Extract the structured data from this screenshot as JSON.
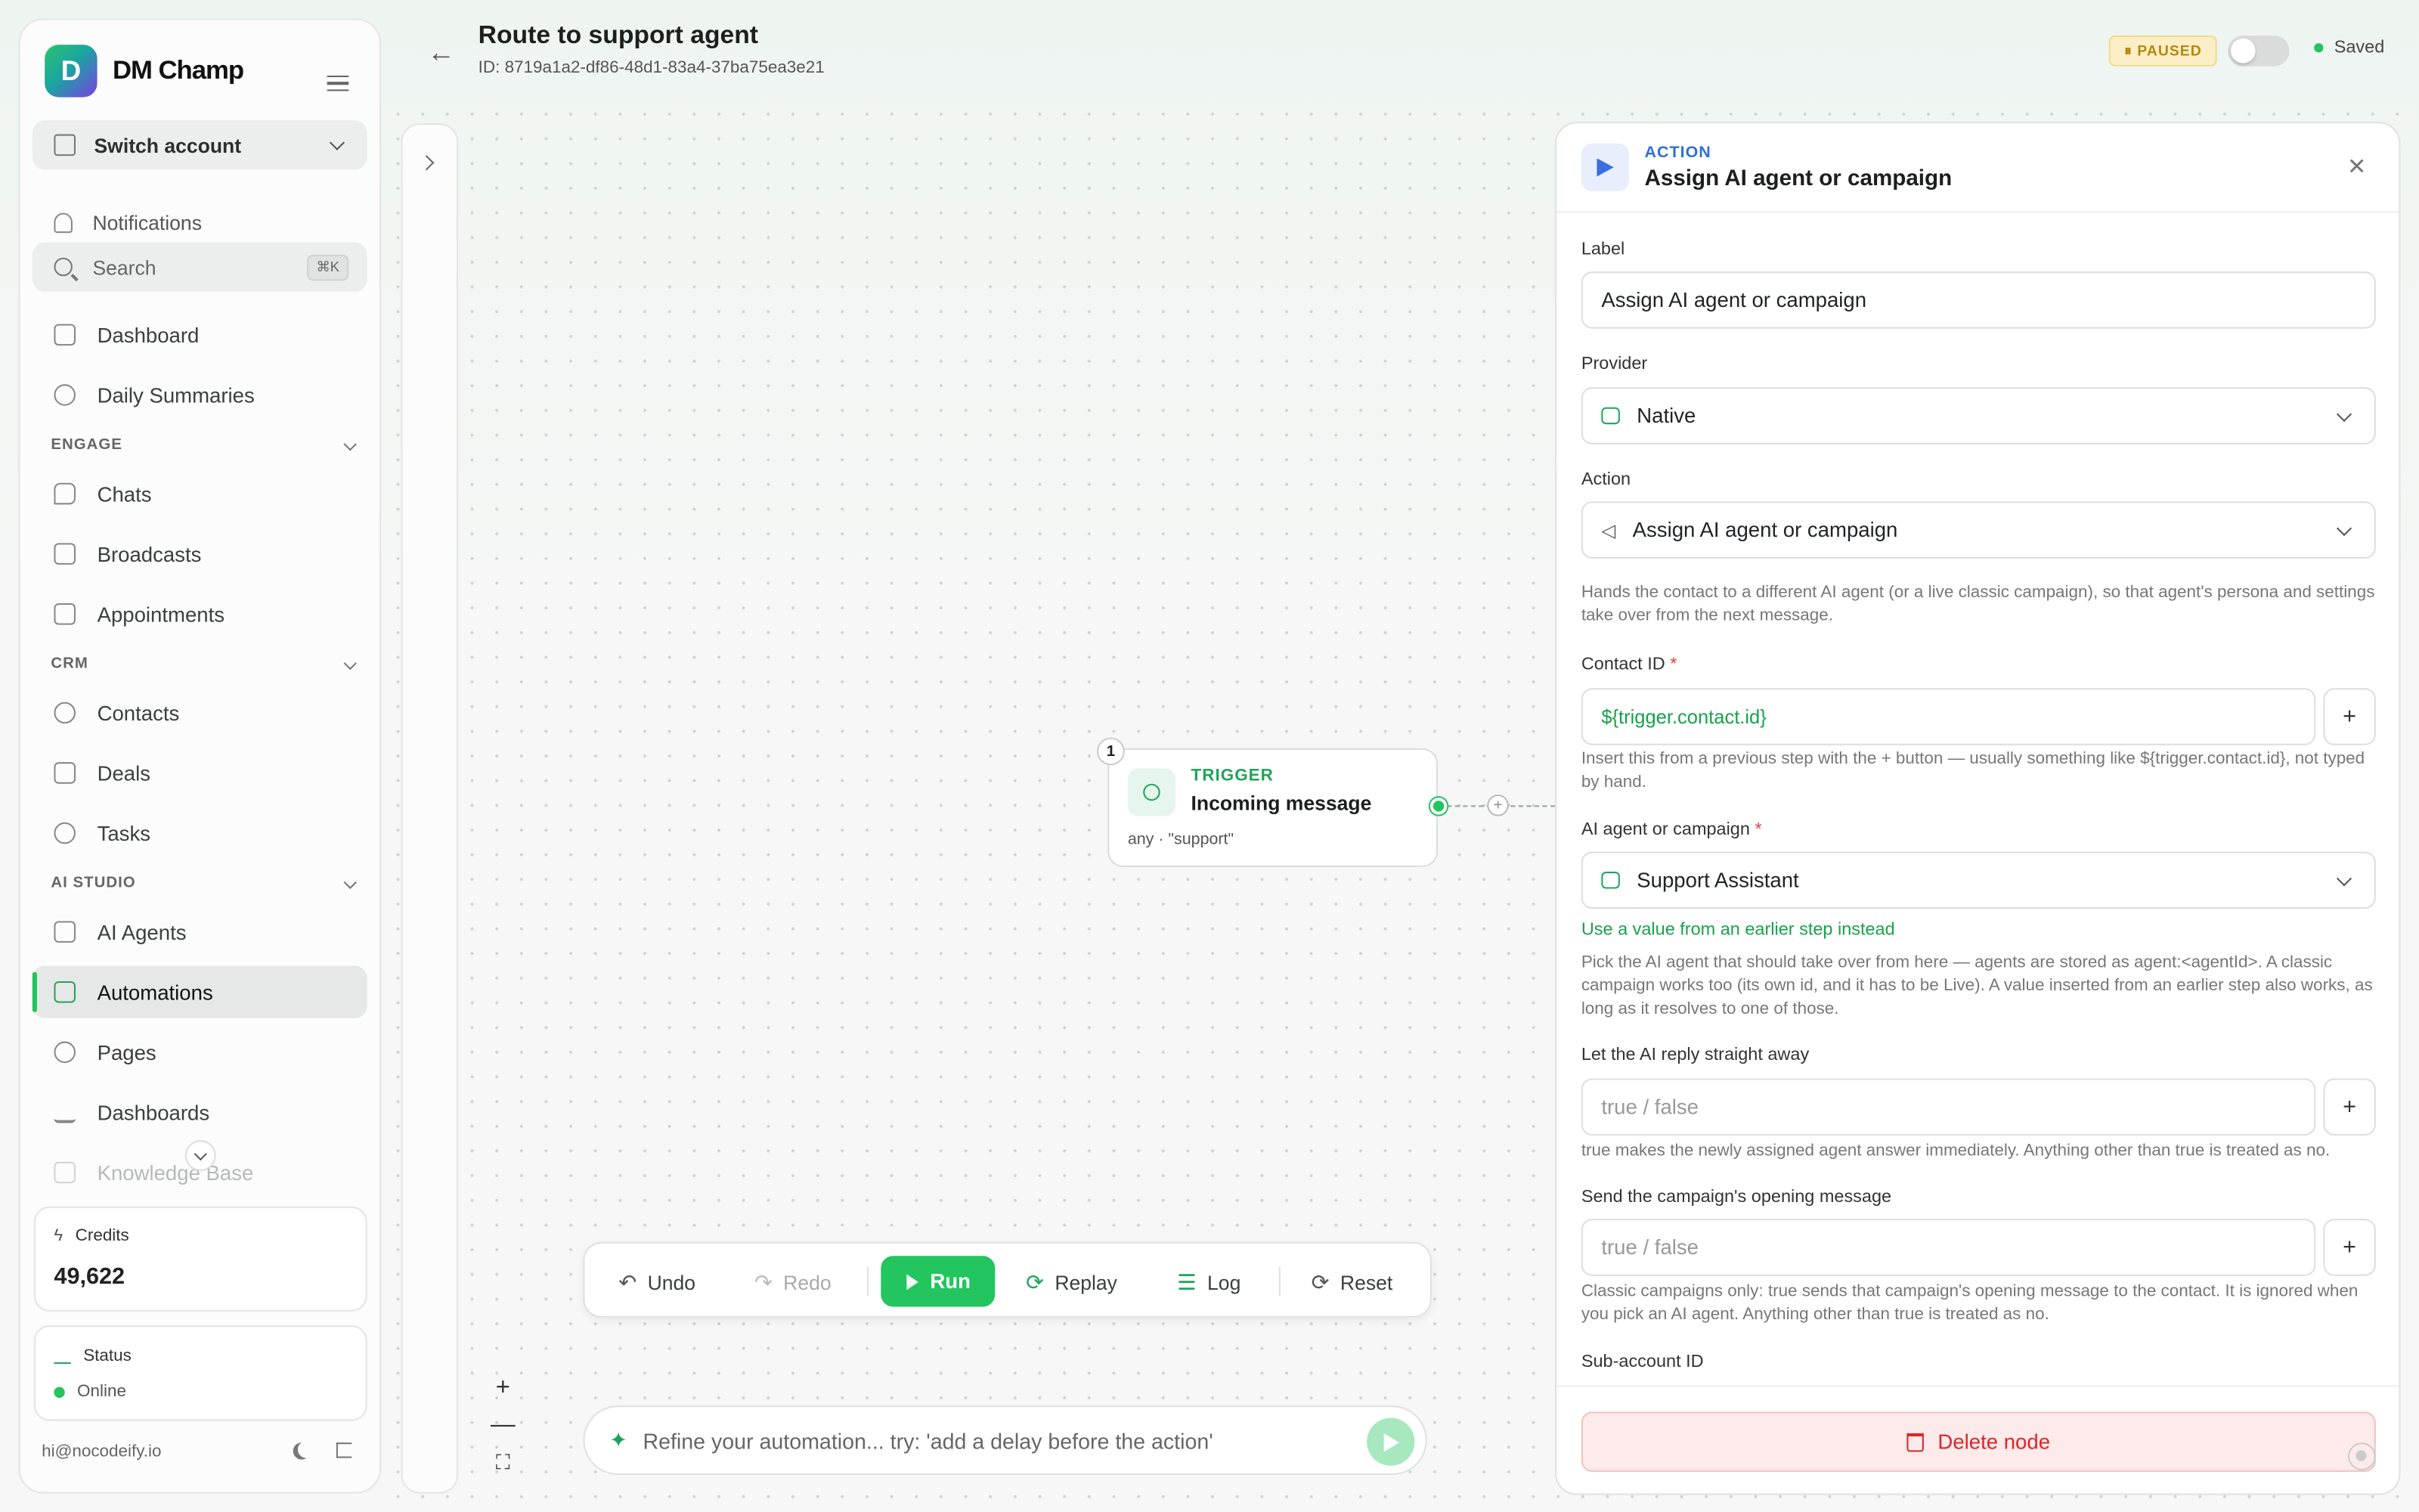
{
  "sidebar": {
    "brand": "DM Champ",
    "logo_letter": "D",
    "switch_account": "Switch account",
    "notifications": "Notifications",
    "search": {
      "placeholder": "Search",
      "shortcut": "⌘K"
    },
    "items_top": [
      {
        "label": "Dashboard",
        "icon": "grid-icon"
      },
      {
        "label": "Daily Summaries",
        "icon": "sparkles-icon"
      }
    ],
    "sections": [
      {
        "title": "ENGAGE",
        "items": [
          {
            "label": "Chats",
            "icon": "chat-icon"
          },
          {
            "label": "Broadcasts",
            "icon": "megaphone-icon"
          },
          {
            "label": "Appointments",
            "icon": "calendar-icon"
          }
        ]
      },
      {
        "title": "CRM",
        "items": [
          {
            "label": "Contacts",
            "icon": "users-icon"
          },
          {
            "label": "Deals",
            "icon": "briefcase-icon"
          },
          {
            "label": "Tasks",
            "icon": "check-circle-icon"
          }
        ]
      },
      {
        "title": "AI STUDIO",
        "items": [
          {
            "label": "AI Agents",
            "icon": "cpu-icon"
          },
          {
            "label": "Automations",
            "icon": "robot-icon",
            "active": true
          },
          {
            "label": "Pages",
            "icon": "globe-icon"
          },
          {
            "label": "Dashboards",
            "icon": "bar-chart-icon"
          },
          {
            "label": "Knowledge Base",
            "icon": "book-icon"
          }
        ]
      }
    ],
    "credits": {
      "label": "Credits",
      "value": "49,622"
    },
    "status": {
      "label": "Status",
      "value": "Online"
    },
    "email": "hi@nocodeify.io"
  },
  "header": {
    "title": "Route to support agent",
    "id_text": "ID: 8719a1a2-df86-48d1-83a4-37ba75ea3e21",
    "paused_badge": "⏸ PAUSED",
    "saved": "Saved"
  },
  "canvas": {
    "node": {
      "number": "1",
      "kind": "TRIGGER",
      "name": "Incoming message",
      "meta": "any · \"support\""
    },
    "edge_plus": "+",
    "toolbar": {
      "undo": "Undo",
      "redo": "Redo",
      "run": "Run",
      "replay": "Replay",
      "log": "Log",
      "reset": "Reset"
    },
    "zoom": {
      "in": "+",
      "out": "—",
      "fit": "⛶"
    },
    "prompt_placeholder": "Refine your automation... try: 'add a delay before the action'"
  },
  "panel": {
    "kind": "ACTION",
    "title": "Assign AI agent or campaign",
    "close": "✕",
    "fields": {
      "label": {
        "label": "Label",
        "value": "Assign AI agent or campaign"
      },
      "provider": {
        "label": "Provider",
        "value": "Native"
      },
      "action": {
        "label": "Action",
        "value": "Assign AI agent or campaign"
      },
      "action_help": "Hands the contact to a different AI agent (or a live classic campaign), so that agent's persona and settings take over from the next message.",
      "contact_id": {
        "label": "Contact ID",
        "required": "*",
        "value": "${trigger.contact.id}",
        "help": "Insert this from a previous step with the + button — usually something like ${trigger.contact.id}, not typed by hand."
      },
      "agent": {
        "label": "AI agent or campaign",
        "required": "*",
        "value": "Support Assistant",
        "link": "Use a value from an earlier step instead",
        "help": "Pick the AI agent that should take over from here — agents are stored as agent:<agentId>. A classic campaign works too (its own id, and it has to be Live). A value inserted from an earlier step also works, as long as it resolves to one of those."
      },
      "reply": {
        "label": "Let the AI reply straight away",
        "placeholder": "true / false",
        "help": "true makes the newly assigned agent answer immediately. Anything other than true is treated as no."
      },
      "opening": {
        "label": "Send the campaign's opening message",
        "placeholder": "true / false",
        "help": "Classic campaigns only: true sends that campaign's opening message to the contact. It is ignored when you pick an AI agent. Anything other than true is treated as no."
      },
      "subaccount": {
        "label": "Sub-account ID"
      }
    },
    "plus": "+",
    "delete": "Delete node"
  },
  "colors": {
    "accent": "#22c55e",
    "action_blue": "#2f6fd8",
    "danger": "#dc2626",
    "paused": "#b7870c"
  }
}
